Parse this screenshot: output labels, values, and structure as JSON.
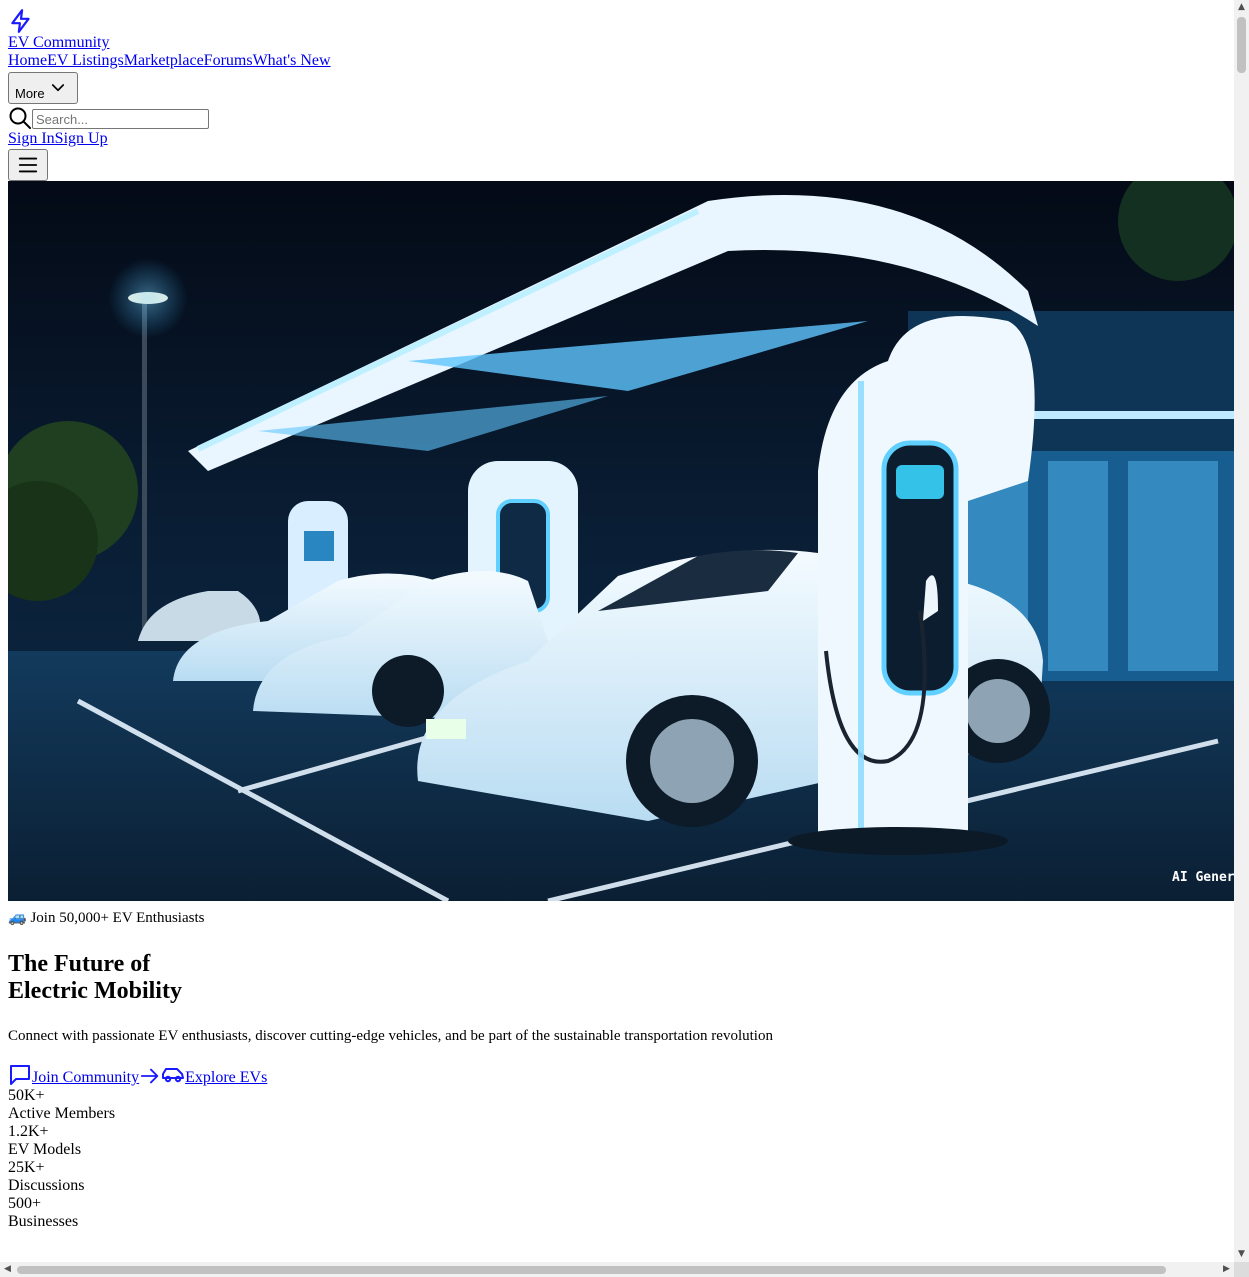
{
  "brand": {
    "name": "EV Community",
    "icon": "lightning-bolt-icon"
  },
  "nav": {
    "items": [
      {
        "label": "Home"
      },
      {
        "label": "EV Listings"
      },
      {
        "label": "Marketplace"
      },
      {
        "label": "Forums"
      },
      {
        "label": "What's New"
      }
    ],
    "more_label": "More"
  },
  "search": {
    "placeholder": "Search..."
  },
  "auth": {
    "sign_in": "Sign In",
    "sign_up": "Sign Up"
  },
  "hero": {
    "image_alt": "Electric vehicles charging at a futuristic charging station at night",
    "image_label": "AI Generated",
    "badge_emoji": "🚙",
    "badge_text": "Join 50,000+ EV Enthusiasts",
    "title_line1": "The Future of",
    "title_line2": "Electric Mobility",
    "description": "Connect with passionate EV enthusiasts, discover cutting-edge vehicles, and be part of the sustainable transportation revolution",
    "cta_primary": "Join Community",
    "cta_secondary": "Explore EVs"
  },
  "stats": [
    {
      "value": "50K+",
      "label": "Active Members"
    },
    {
      "value": "1.2K+",
      "label": "EV Models"
    },
    {
      "value": "25K+",
      "label": "Discussions"
    },
    {
      "value": "500+",
      "label": "Businesses"
    }
  ],
  "colors": {
    "link": "#0000ee",
    "brand_icon": "#1a1aff",
    "hero_glow": "#38b6ff"
  }
}
